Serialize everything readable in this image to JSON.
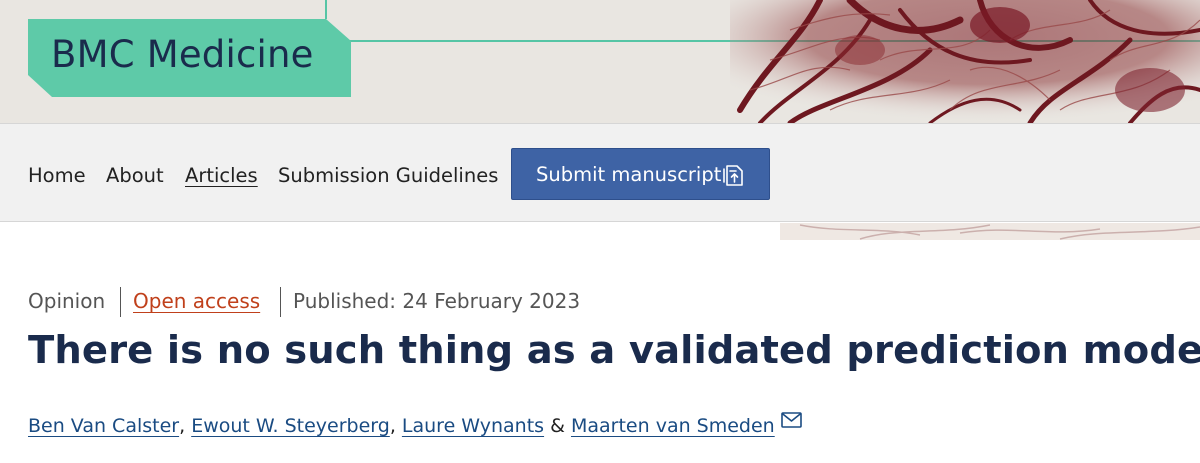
{
  "journal": {
    "name": "BMC Medicine"
  },
  "nav": {
    "items": [
      {
        "label": "Home"
      },
      {
        "label": "About"
      },
      {
        "label": "Articles"
      },
      {
        "label": "Submission Guidelines"
      }
    ],
    "submit_label": "Submit manuscript",
    "submit_icon": "submit-manuscript-icon"
  },
  "article": {
    "type": "Opinion",
    "access": "Open access",
    "published": "Published: 24 February 2023",
    "title": "There is no such thing as a validated prediction model",
    "authors": [
      {
        "name": "Ben Van Calster",
        "after": ", "
      },
      {
        "name": "Ewout W. Steyerberg",
        "after": ", "
      },
      {
        "name": "Laure Wynants",
        "after": " & "
      },
      {
        "name": "Maarten van Smeden",
        "after": ""
      }
    ],
    "contact_icon": "mail-icon"
  },
  "colors": {
    "brand_green": "#5ecaa8",
    "brand_navy": "#1a2b4c",
    "button_blue": "#3e63a5",
    "open_access_orange": "#c0401b",
    "author_link": "#1a4b82"
  }
}
